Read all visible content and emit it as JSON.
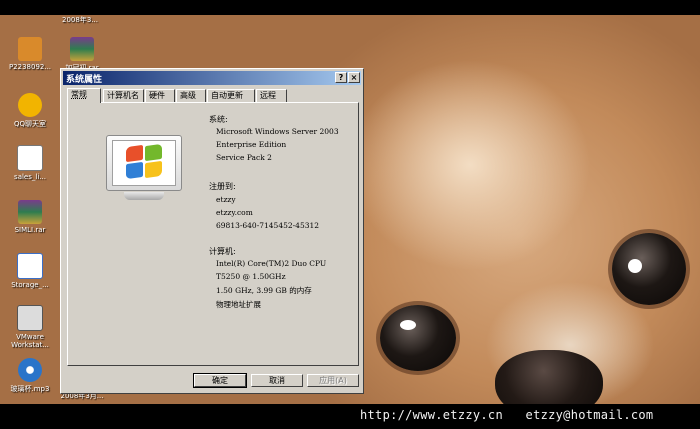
{
  "desktop": {
    "icons": [
      {
        "label": "P2238092...",
        "icon": "image-file-icon",
        "color": "#d98a2b"
      },
      {
        "label": "QQ聊天室",
        "icon": "qq-chat-icon",
        "color": "#f2b400"
      },
      {
        "label": "sales_li...",
        "icon": "document-icon",
        "color": "#ffffff"
      },
      {
        "label": "SIMLI.rar",
        "icon": "rar-archive-icon",
        "color": "#7a3b8c"
      },
      {
        "label": "Storage_...",
        "icon": "word-document-icon",
        "color": "#3b6fc7"
      },
      {
        "label": "VMware Workstat...",
        "icon": "vmware-icon",
        "color": "#dcdcdc"
      },
      {
        "label": "玻璃杯.mp3",
        "icon": "mp3-audio-icon",
        "color": "#2a74c9"
      }
    ],
    "partial_labels": {
      "top_right_label": "2008年3...",
      "rar2_label": "加冠初.rar",
      "bottom_label": "2008年3月..."
    }
  },
  "dialog": {
    "title": "系统属性",
    "help_button": "?",
    "close_button": "×",
    "tabs": [
      "常规",
      "计算机名",
      "硬件",
      "高级",
      "自动更新",
      "远程"
    ],
    "active_tab": "常规",
    "system": {
      "heading": "系统:",
      "lines": [
        "Microsoft Windows Server 2003",
        "Enterprise Edition",
        "Service Pack 2"
      ]
    },
    "registered": {
      "heading": "注册到:",
      "lines": [
        "etzzy",
        "etzzy.com",
        "69813-640-7145452-45312"
      ]
    },
    "computer": {
      "heading": "计算机:",
      "lines": [
        "Intel(R) Core(TM)2 Duo CPU",
        "T5250  @ 1.50GHz",
        "1.50 GHz, 3.99 GB 的内存",
        "物理地址扩展"
      ]
    },
    "buttons": {
      "ok": "确定",
      "cancel": "取消",
      "apply": "应用(A)"
    }
  },
  "footer": {
    "text": "http://www.etzzy.cn   etzzy@hotmail.com"
  },
  "colors": {
    "titlebar_start": "#0a246a",
    "titlebar_end": "#a6caf0",
    "dialog_face": "#d4d0c8"
  }
}
